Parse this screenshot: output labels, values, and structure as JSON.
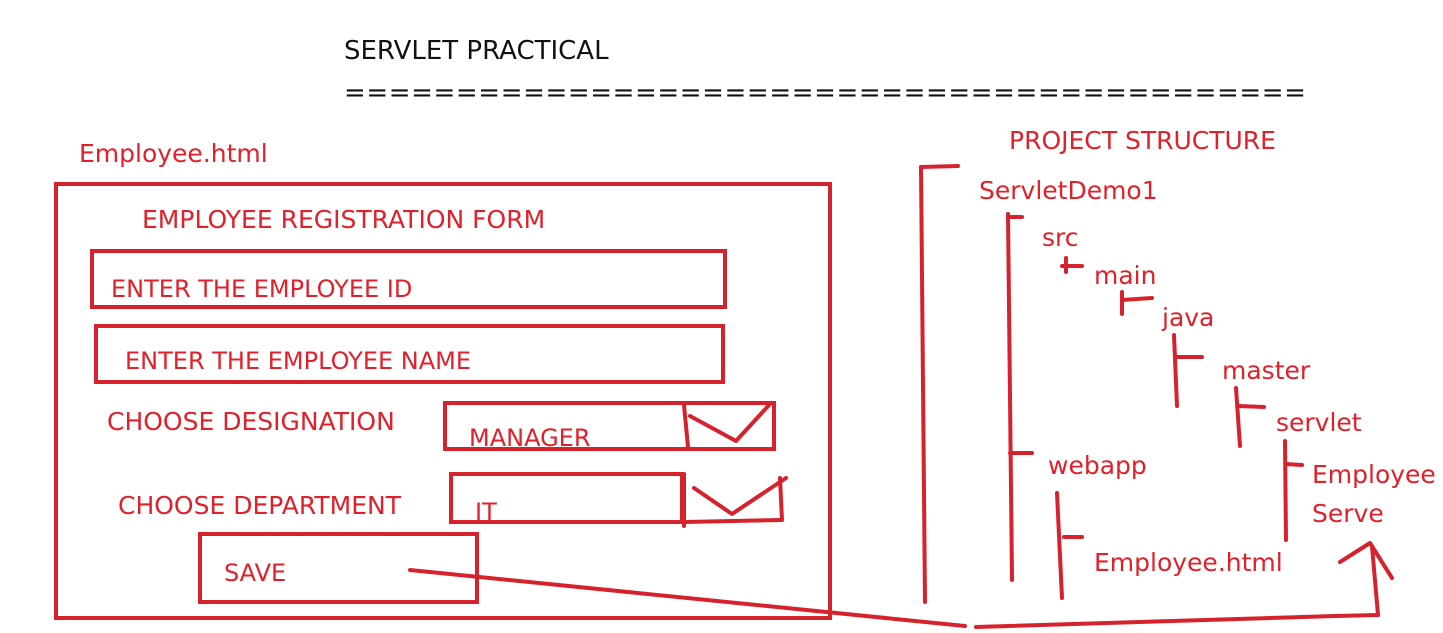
{
  "header": {
    "title": "SERVLET PRACTICAL",
    "underline": "==========================================="
  },
  "form_file_label": "Employee.html",
  "form": {
    "heading": "EMPLOYEE REGISTRATION FORM",
    "employee_id_placeholder": "ENTER THE EMPLOYEE ID",
    "employee_name_placeholder": "ENTER THE EMPLOYEE NAME",
    "designation_label": "CHOOSE DESIGNATION",
    "designation_value": "MANAGER",
    "department_label": "CHOOSE DEPARTMENT",
    "department_value": "IT",
    "save_label": "SAVE"
  },
  "project_structure": {
    "heading": "PROJECT STRUCTURE",
    "nodes": {
      "root": "ServletDemo1",
      "src": "src",
      "main": "main",
      "java": "java",
      "master": "master",
      "servlet": "servlet",
      "servlet_class_line1": "Employee",
      "servlet_class_line2": "Serve",
      "webapp": "webapp",
      "html_file": "Employee.html"
    }
  },
  "colors": {
    "ink": "#e0202a",
    "stroke": "#d6222c",
    "title": "#111111",
    "background": "#ffffff"
  }
}
